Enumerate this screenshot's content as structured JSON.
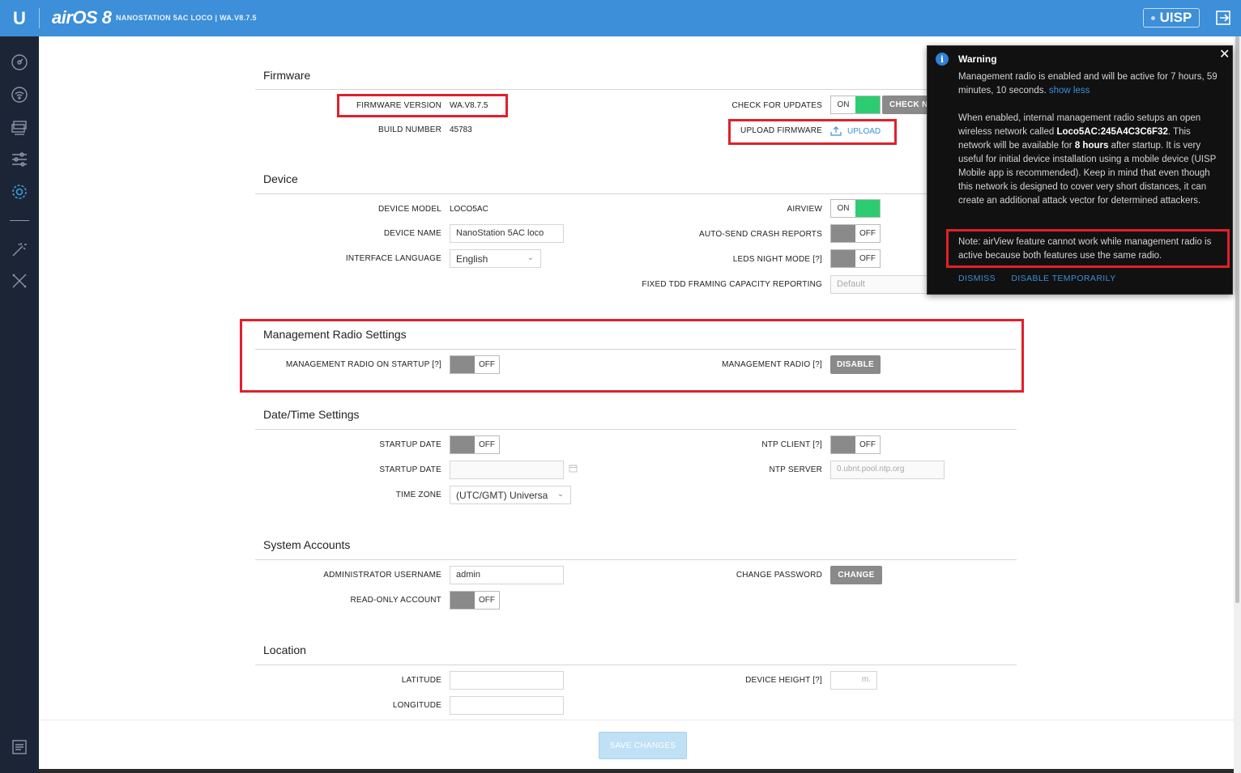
{
  "header": {
    "logo": "U",
    "brand": "airOS 8",
    "subtitle": "NANOSTATION 5AC LOCO | WA.V8.7.5",
    "uisp_label": "UISP"
  },
  "sidebar": {
    "icons": [
      "dashboard-icon",
      "wireless-icon",
      "network-icon",
      "services-icon",
      "system-icon",
      "tools-wand-icon",
      "tools-icon",
      "log-icon"
    ]
  },
  "firmware": {
    "title": "Firmware",
    "version_label": "FIRMWARE VERSION",
    "version_value": "WA.V8.7.5",
    "build_label": "BUILD NUMBER",
    "build_value": "45783",
    "check_updates_label": "CHECK FOR UPDATES",
    "check_updates_state": "ON",
    "check_now_label": "CHECK N",
    "upload_label": "UPLOAD FIRMWARE",
    "upload_link": "UPLOAD"
  },
  "device": {
    "title": "Device",
    "model_label": "DEVICE MODEL",
    "model_value": "LOCO5AC",
    "name_label": "DEVICE NAME",
    "name_value": "NanoStation 5AC loco",
    "language_label": "INTERFACE LANGUAGE",
    "language_value": "English",
    "airview_label": "AIRVIEW",
    "airview_state": "ON",
    "crash_label": "AUTO-SEND CRASH REPORTS",
    "crash_state": "OFF",
    "leds_label": "LEDS NIGHT MODE [?]",
    "leds_state": "OFF",
    "tdd_label": "FIXED TDD FRAMING CAPACITY REPORTING",
    "tdd_value": "Default"
  },
  "mgmt": {
    "title": "Management Radio Settings",
    "startup_label": "MANAGEMENT RADIO ON STARTUP [?]",
    "startup_state": "OFF",
    "radio_label": "MANAGEMENT RADIO [?]",
    "radio_button": "DISABLE"
  },
  "datetime": {
    "title": "Date/Time Settings",
    "startup_date_toggle_label": "STARTUP DATE",
    "startup_date_toggle_state": "OFF",
    "startup_date_label": "STARTUP DATE",
    "timezone_label": "TIME ZONE",
    "timezone_value": "(UTC/GMT) Universa",
    "ntp_client_label": "NTP CLIENT [?]",
    "ntp_client_state": "OFF",
    "ntp_server_label": "NTP SERVER",
    "ntp_server_placeholder": "0.ubnt.pool.ntp.org"
  },
  "accounts": {
    "title": "System Accounts",
    "admin_label": "ADMINISTRATOR USERNAME",
    "admin_value": "admin",
    "readonly_label": "READ-ONLY ACCOUNT",
    "readonly_state": "OFF",
    "password_label": "CHANGE PASSWORD",
    "password_button": "CHANGE"
  },
  "location": {
    "title": "Location",
    "latitude_label": "LATITUDE",
    "longitude_label": "LONGITUDE",
    "height_label": "DEVICE HEIGHT [?]",
    "height_unit": "m."
  },
  "warning": {
    "title": "Warning",
    "line1": "Management radio is enabled and will be active for 7 hours, 59 minutes, 10 seconds.",
    "show_less": "show less",
    "para2_a": "When enabled, internal management radio setups an open wireless network called ",
    "ssid": "Loco5AC:245A4C3C6F32",
    "para2_b": ". This network will be available for ",
    "hours": "8 hours",
    "para2_c": " after startup. It is very useful for initial device installation using a mobile device (UISP Mobile app is recommended). Keep in mind that even though this network is designed to cover very short distances, it can create an additional attack vector for determined attackers.",
    "note": "Note: airView feature cannot work while management radio is active because both features use the same radio.",
    "dismiss": "DISMISS",
    "disable_temp": "DISABLE TEMPORARILY"
  },
  "footer": {
    "save_label": "SAVE CHANGES"
  }
}
